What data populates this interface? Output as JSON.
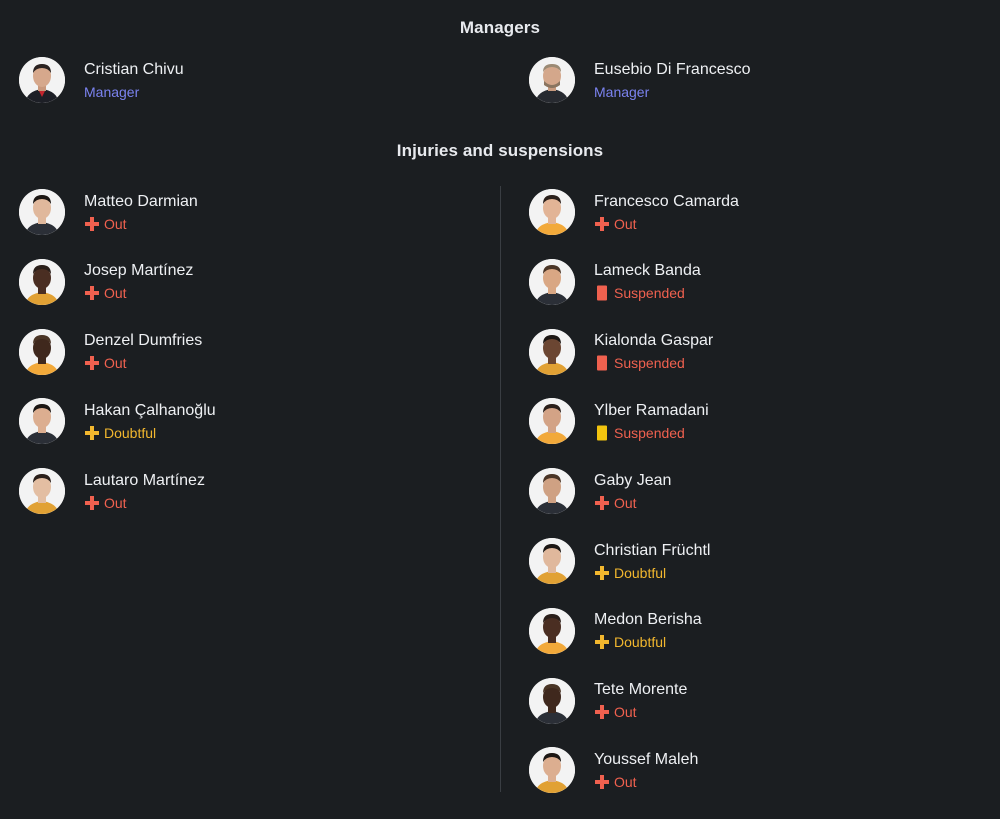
{
  "managers": {
    "title": "Managers",
    "items": [
      {
        "name": "Cristian Chivu",
        "role": "Manager"
      },
      {
        "name": "Eusebio Di Francesco",
        "role": "Manager"
      }
    ]
  },
  "injuries": {
    "title": "Injuries and suspensions",
    "left": [
      {
        "name": "Matteo Darmian",
        "status": "Out",
        "icon": "red-cross-icon"
      },
      {
        "name": "Josep Martínez",
        "status": "Out",
        "icon": "red-cross-icon"
      },
      {
        "name": "Denzel Dumfries",
        "status": "Out",
        "icon": "red-cross-icon"
      },
      {
        "name": "Hakan Çalhanoğlu",
        "status": "Doubtful",
        "icon": "yellow-cross-icon"
      },
      {
        "name": "Lautaro Martínez",
        "status": "Out",
        "icon": "red-cross-icon"
      }
    ],
    "right": [
      {
        "name": "Francesco Camarda",
        "status": "Out",
        "icon": "red-cross-icon"
      },
      {
        "name": "Lameck Banda",
        "status": "Suspended",
        "icon": "red-card-icon"
      },
      {
        "name": "Kialonda Gaspar",
        "status": "Suspended",
        "icon": "red-card-icon"
      },
      {
        "name": "Ylber Ramadani",
        "status": "Suspended",
        "icon": "yellow-card-icon"
      },
      {
        "name": "Gaby Jean",
        "status": "Out",
        "icon": "red-cross-icon"
      },
      {
        "name": "Christian Früchtl",
        "status": "Doubtful",
        "icon": "yellow-cross-icon"
      },
      {
        "name": "Medon Berisha",
        "status": "Doubtful",
        "icon": "yellow-cross-icon"
      },
      {
        "name": "Tete Morente",
        "status": "Out",
        "icon": "red-cross-icon"
      },
      {
        "name": "Youssef Maleh",
        "status": "Out",
        "icon": "red-cross-icon"
      }
    ]
  },
  "colors": {
    "background": "#1b1e21",
    "manager_role": "#7b83f0",
    "out": "#f0614f",
    "doubtful": "#f2b72e",
    "red_card": "#f0614f",
    "yellow_card": "#f2c40f",
    "divider": "#3a3e43"
  }
}
